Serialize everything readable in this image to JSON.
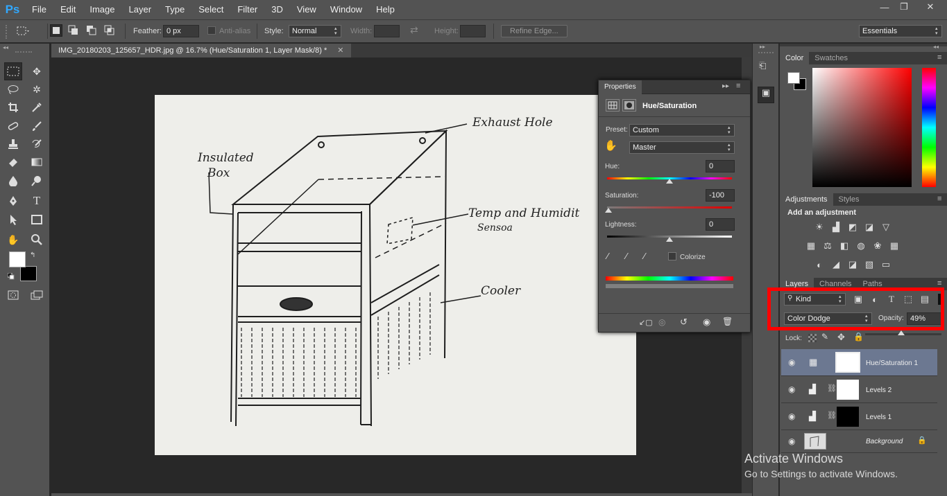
{
  "app": {
    "logo": "Ps"
  },
  "menu": [
    "File",
    "Edit",
    "Image",
    "Layer",
    "Type",
    "Select",
    "Filter",
    "3D",
    "View",
    "Window",
    "Help"
  ],
  "window_controls": {
    "minimize": "—",
    "restore": "❐",
    "close": "✕"
  },
  "options": {
    "feather_label": "Feather:",
    "feather_value": "0 px",
    "antialias_label": "Anti-alias",
    "style_label": "Style:",
    "style_value": "Normal",
    "width_label": "Width:",
    "height_label": "Height:",
    "refine_edge": "Refine Edge...",
    "workspace": "Essentials"
  },
  "document": {
    "tab_title": "IMG_20180203_125657_HDR.jpg @ 16.7% (Hue/Saturation 1, Layer Mask/8) *",
    "close": "✕"
  },
  "sketch_labels": {
    "exhaust": "Exhaust Hole",
    "insulated": "Insulated",
    "box": "Box",
    "temp": "Temp and Humidit",
    "sensor": "Sensoa",
    "cooler": "Cooler"
  },
  "properties": {
    "tab": "Properties",
    "title": "Hue/Saturation",
    "preset_label": "Preset:",
    "preset_value": "Custom",
    "channel_value": "Master",
    "hue_label": "Hue:",
    "hue_value": "0",
    "saturation_label": "Saturation:",
    "saturation_value": "-100",
    "lightness_label": "Lightness:",
    "lightness_value": "0",
    "colorize_label": "Colorize"
  },
  "color_panel": {
    "tabs": [
      "Color",
      "Swatches"
    ]
  },
  "adjustments": {
    "tabs": [
      "Adjustments",
      "Styles"
    ],
    "heading": "Add an adjustment"
  },
  "layers_panel": {
    "tabs": [
      "Layers",
      "Channels",
      "Paths"
    ],
    "filter_kind": "Kind",
    "blend_mode": "Color Dodge",
    "opacity_label": "Opacity:",
    "opacity_value": "49%",
    "lock_label": "Lock:",
    "layers": [
      {
        "name": "Hue/Saturation 1"
      },
      {
        "name": "Levels 2"
      },
      {
        "name": "Levels 1"
      },
      {
        "name": "Background"
      }
    ]
  },
  "watermark": {
    "line1": "Activate Windows",
    "line2": "Go to Settings to activate Windows."
  },
  "colors": {
    "highlight_box": "#ff0000",
    "ps_blue": "#31a8ff",
    "selected_layer": "#6c7891"
  }
}
